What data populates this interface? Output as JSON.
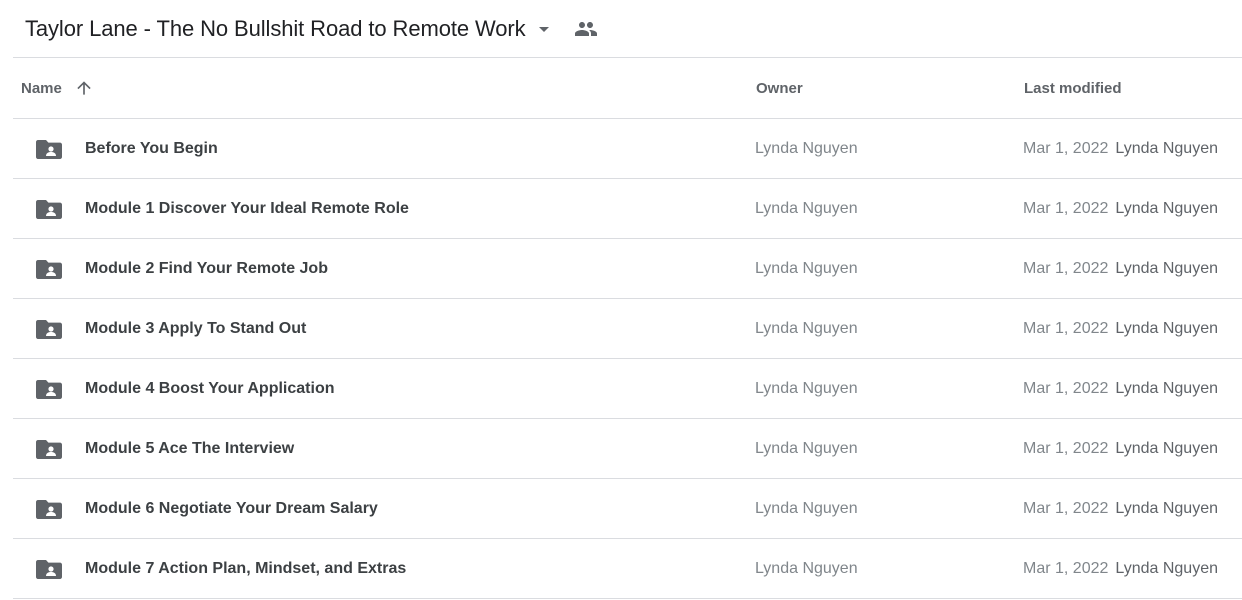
{
  "header": {
    "title": "Taylor Lane - The No Bullshit Road to Remote Work",
    "dropdown_icon": "arrow-drop-down-icon",
    "shared_icon": "people-icon"
  },
  "columns": {
    "name": "Name",
    "owner": "Owner",
    "last_modified": "Last modified",
    "sort_icon": "arrow-up-icon"
  },
  "rows": [
    {
      "name": "Before You Begin",
      "owner": "Lynda Nguyen",
      "modified_date": "Mar 1, 2022",
      "modified_by": "Lynda Nguyen",
      "icon": "shared-folder-icon"
    },
    {
      "name": "Module 1 Discover Your Ideal Remote Role",
      "owner": "Lynda Nguyen",
      "modified_date": "Mar 1, 2022",
      "modified_by": "Lynda Nguyen",
      "icon": "shared-folder-icon"
    },
    {
      "name": "Module 2 Find Your Remote Job",
      "owner": "Lynda Nguyen",
      "modified_date": "Mar 1, 2022",
      "modified_by": "Lynda Nguyen",
      "icon": "shared-folder-icon"
    },
    {
      "name": "Module 3 Apply To Stand Out",
      "owner": "Lynda Nguyen",
      "modified_date": "Mar 1, 2022",
      "modified_by": "Lynda Nguyen",
      "icon": "shared-folder-icon"
    },
    {
      "name": "Module 4 Boost Your Application",
      "owner": "Lynda Nguyen",
      "modified_date": "Mar 1, 2022",
      "modified_by": "Lynda Nguyen",
      "icon": "shared-folder-icon"
    },
    {
      "name": "Module 5 Ace The Interview",
      "owner": "Lynda Nguyen",
      "modified_date": "Mar 1, 2022",
      "modified_by": "Lynda Nguyen",
      "icon": "shared-folder-icon"
    },
    {
      "name": "Module 6 Negotiate Your Dream Salary",
      "owner": "Lynda Nguyen",
      "modified_date": "Mar 1, 2022",
      "modified_by": "Lynda Nguyen",
      "icon": "shared-folder-icon"
    },
    {
      "name": "Module 7 Action Plan, Mindset, and Extras",
      "owner": "Lynda Nguyen",
      "modified_date": "Mar 1, 2022",
      "modified_by": "Lynda Nguyen",
      "icon": "shared-folder-icon"
    }
  ],
  "colors": {
    "icon_gray": "#5f6368",
    "divider": "#dadce0",
    "text_primary": "#202124",
    "text_secondary": "#80868b"
  }
}
